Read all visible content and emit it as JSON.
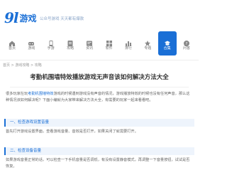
{
  "logo": {
    "mark": "9l",
    "name": "游戏",
    "slogan": "公众号游戏  天天都有爆款"
  },
  "nav": {
    "items": [
      {
        "label": "首页"
      },
      {
        "label": "游戏"
      },
      {
        "label": "手游"
      },
      {
        "label": "攻略"
      },
      {
        "label": "资讯"
      },
      {
        "label": "软件"
      },
      {
        "label": "排行"
      },
      {
        "label": "专题"
      },
      {
        "label": "合集"
      },
      {
        "label": "问答"
      }
    ],
    "active_index": 8
  },
  "breadcrumb": "首页 > 游戏攻略 > 攻略",
  "article": {
    "title": "考勤机围墙特效播放游戏无声音该如何解决方法大全",
    "intro_prefix": "很多玩家在玩",
    "intro_link": "考勤机围墙特效",
    "intro_rest": "游戏的时候遇到游戏没有声音的情况，游戏播放特效的时候也没有任何声音，那么这种情况该如何解决呢？下面小编就为大家带来解决方法大全，有需要的玩家一起来看看吧。",
    "section1": "一、检查游戏设置音量",
    "section1_text": "首先打开游戏设置界面，查看游戏音量、音效是否打开，如果关闭了就需要打开。",
    "section2": "二、检查设备音量",
    "section2_text": "如果游戏音量正常的话，可以检查一下手机音量是否调低，有没有设置静音模式，再调整一下音量按钮，试试是否恢复。"
  },
  "colors": {
    "accent": "#1a6fd6",
    "section_bg": "#eef4fc"
  }
}
